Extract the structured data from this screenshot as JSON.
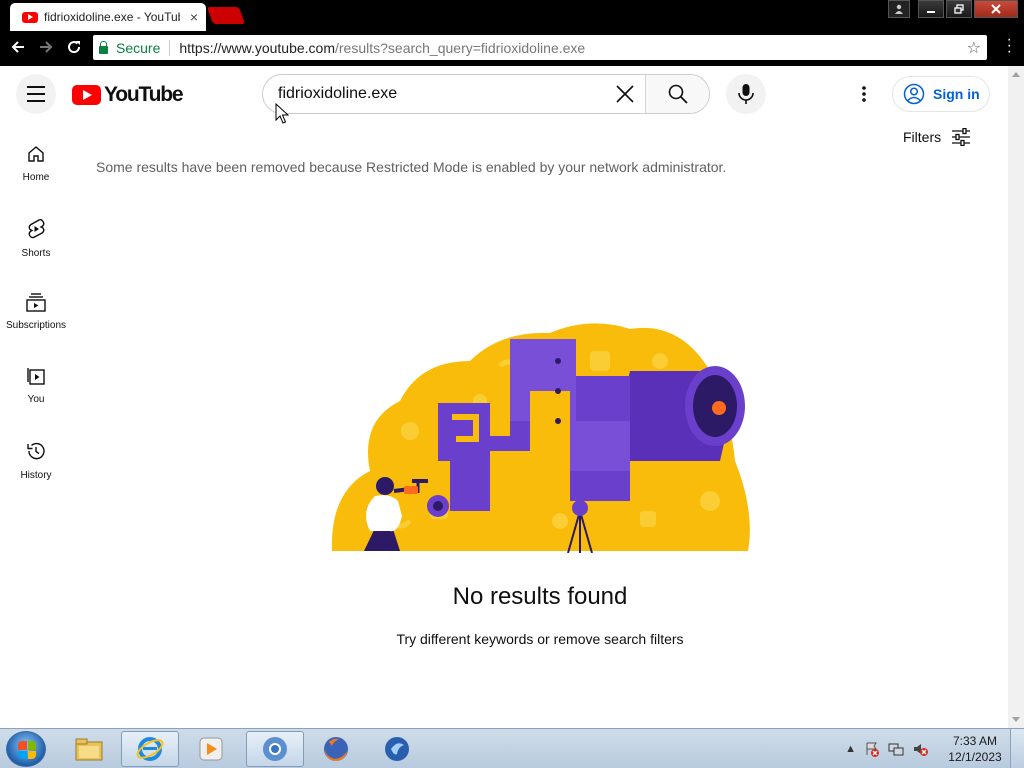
{
  "browser": {
    "tab_title": "fidrioxidoline.exe - YouTube",
    "tab_close": "×",
    "secure_label": "Secure",
    "url_host": "https://www.youtube.com",
    "url_path": "/results?search_query=fidrioxidoline.exe"
  },
  "youtube": {
    "logo_text": "YouTube",
    "search_query": "fidrioxidoline.exe",
    "sign_in": "Sign in",
    "guide": [
      {
        "label": "Home",
        "icon": "home-icon"
      },
      {
        "label": "Shorts",
        "icon": "shorts-icon"
      },
      {
        "label": "Subscriptions",
        "icon": "subscriptions-icon"
      },
      {
        "label": "You",
        "icon": "you-icon"
      },
      {
        "label": "History",
        "icon": "history-icon"
      }
    ],
    "filters_label": "Filters",
    "restricted_notice": "Some results have been removed because Restricted Mode is enabled by your network administrator.",
    "no_results_title": "No results found",
    "no_results_hint": "Try different keywords or remove search filters"
  },
  "taskbar": {
    "pinned": [
      "file-explorer-icon",
      "internet-explorer-icon",
      "media-player-icon",
      "chrome-icon",
      "firefox-icon",
      "app-icon"
    ],
    "active": "chrome-icon",
    "time": "7:33 AM",
    "date": "12/1/2023"
  },
  "colors": {
    "youtube_red": "#ff0000",
    "link_blue": "#065fd4",
    "illustration_yellow": "#f9bc0a",
    "illustration_purple": "#6a3fcb"
  }
}
